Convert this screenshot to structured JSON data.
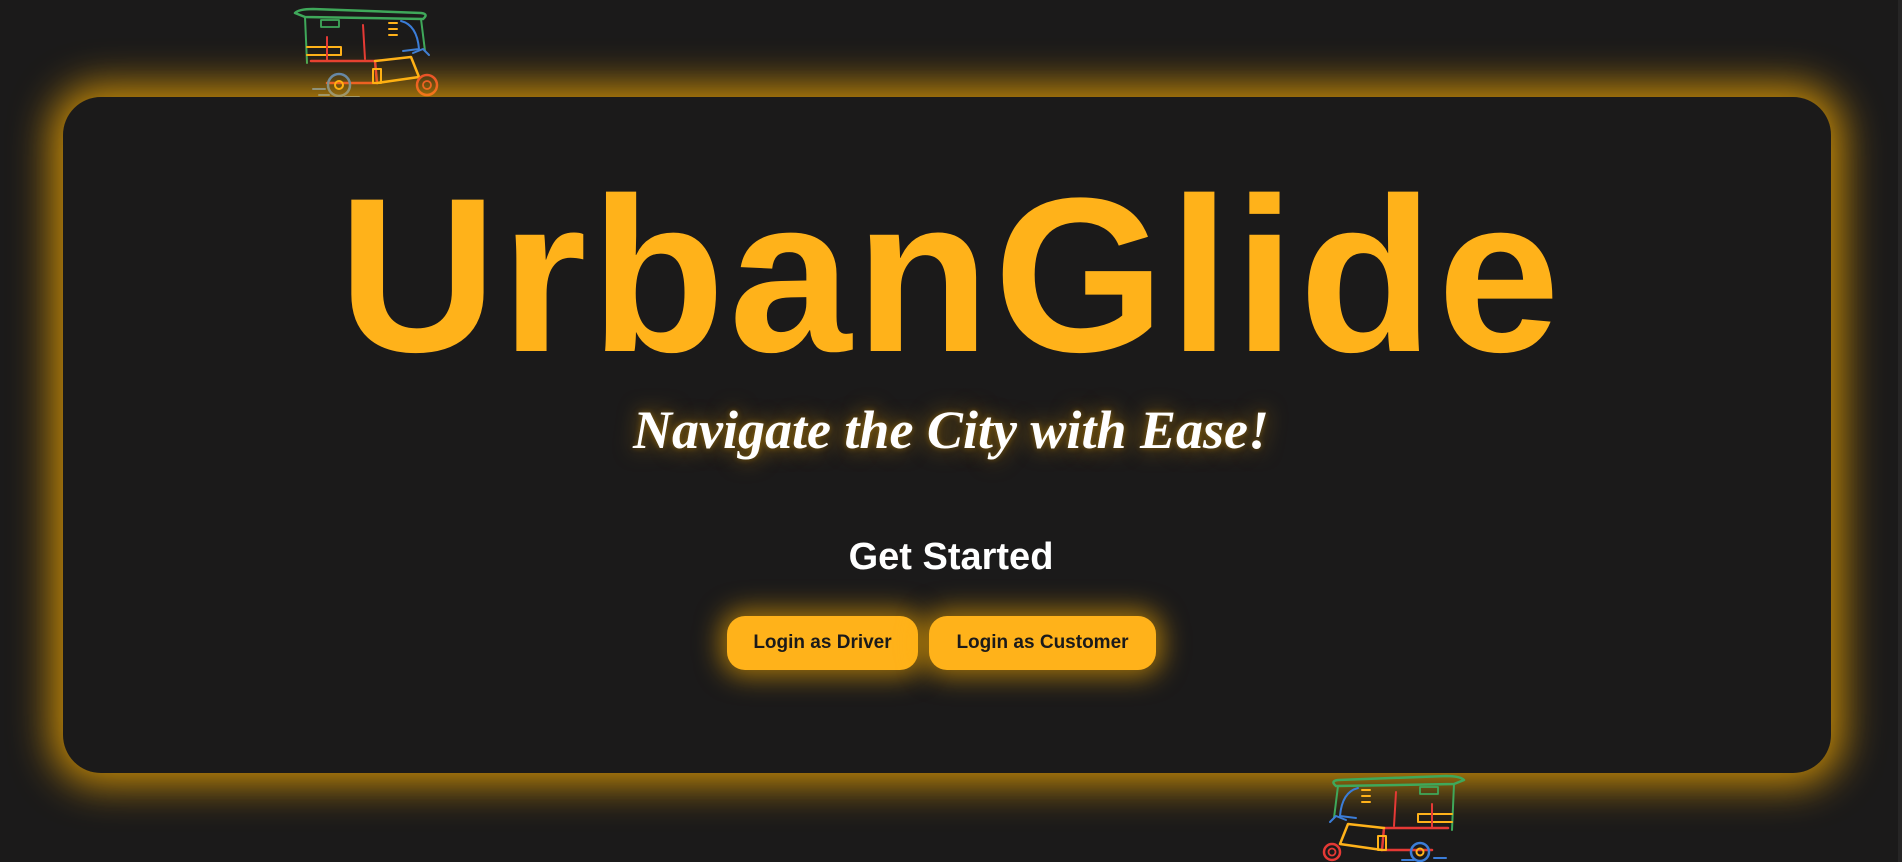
{
  "brand": {
    "title": "UrbanGlide",
    "tagline": "Navigate the City with Ease!"
  },
  "cta": {
    "heading": "Get Started",
    "driver_login_label": "Login as Driver",
    "customer_login_label": "Login as Customer"
  },
  "decorations": {
    "top_icon": "auto-rickshaw-icon",
    "bottom_icon": "auto-rickshaw-icon"
  },
  "colors": {
    "background": "#1b1a1a",
    "accent": "#ffb21a",
    "glow": "#ffb000",
    "text_light": "#ffffff",
    "button_text": "#1b1a1a"
  }
}
